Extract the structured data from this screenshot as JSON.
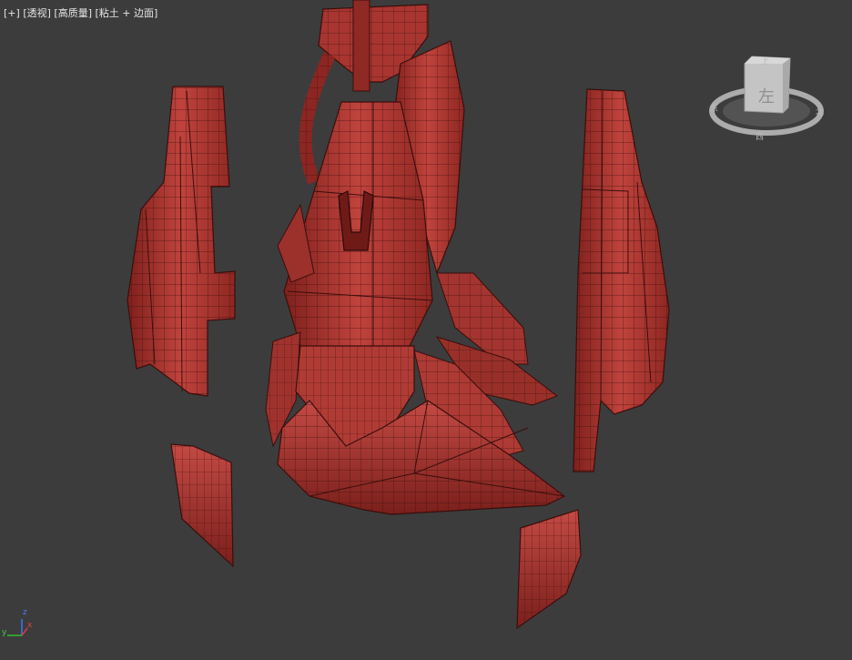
{
  "viewport": {
    "label": {
      "plus": "[+]",
      "view": "[透视]",
      "quality": "[高质量]",
      "shading": "[粘土 + 边面]"
    }
  },
  "viewcube": {
    "face_label": "左",
    "compass": {
      "back": "上",
      "right": "北",
      "front": "西",
      "left": "东"
    }
  },
  "axis_gizmo": {
    "x": "x",
    "y": "y",
    "z": "z"
  },
  "colors": {
    "background": "#3c3c3c",
    "clay": "#b33a35",
    "clay_dark": "#6f1d1a",
    "wire": "#3a0e0c",
    "viewcube": "#bdbdbd"
  }
}
